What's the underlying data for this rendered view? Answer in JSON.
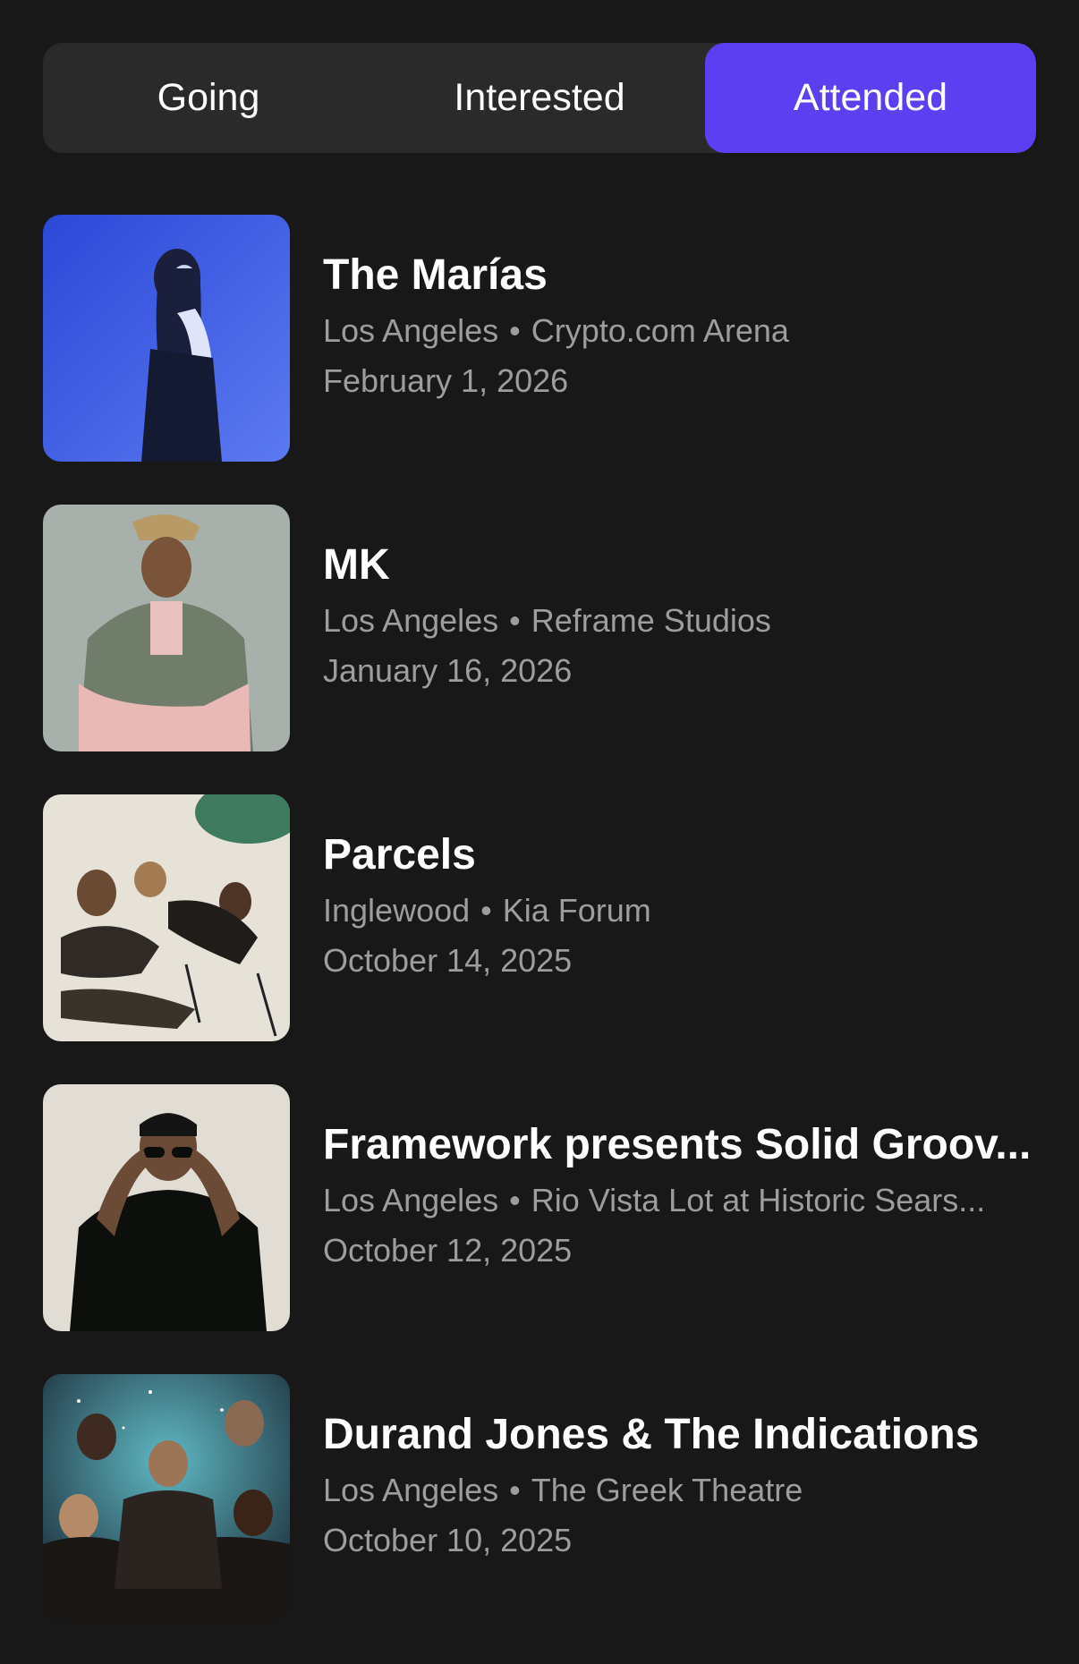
{
  "tabs": [
    {
      "label": "Going"
    },
    {
      "label": "Interested"
    },
    {
      "label": "Attended",
      "active": true
    }
  ],
  "separator": "•",
  "events": [
    {
      "title": "The Marías",
      "city": "Los Angeles",
      "venue": "Crypto.com Arena",
      "date": "February 1, 2026"
    },
    {
      "title": "MK",
      "city": "Los Angeles",
      "venue": "Reframe Studios",
      "date": "January 16, 2026"
    },
    {
      "title": "Parcels",
      "city": "Inglewood",
      "venue": "Kia Forum",
      "date": "October 14, 2025"
    },
    {
      "title": "Framework presents Solid Groov...",
      "city": "Los Angeles",
      "venue": "Rio Vista Lot at Historic Sears...",
      "date": "October 12, 2025"
    },
    {
      "title": "Durand Jones & The Indications",
      "city": "Los Angeles",
      "venue": "The Greek Theatre",
      "date": "October 10, 2025"
    }
  ],
  "colors": {
    "background": "#181818",
    "tab_bar": "#2a2a2a",
    "accent": "#5b3ff0",
    "secondary_text": "#9d9d9d"
  }
}
